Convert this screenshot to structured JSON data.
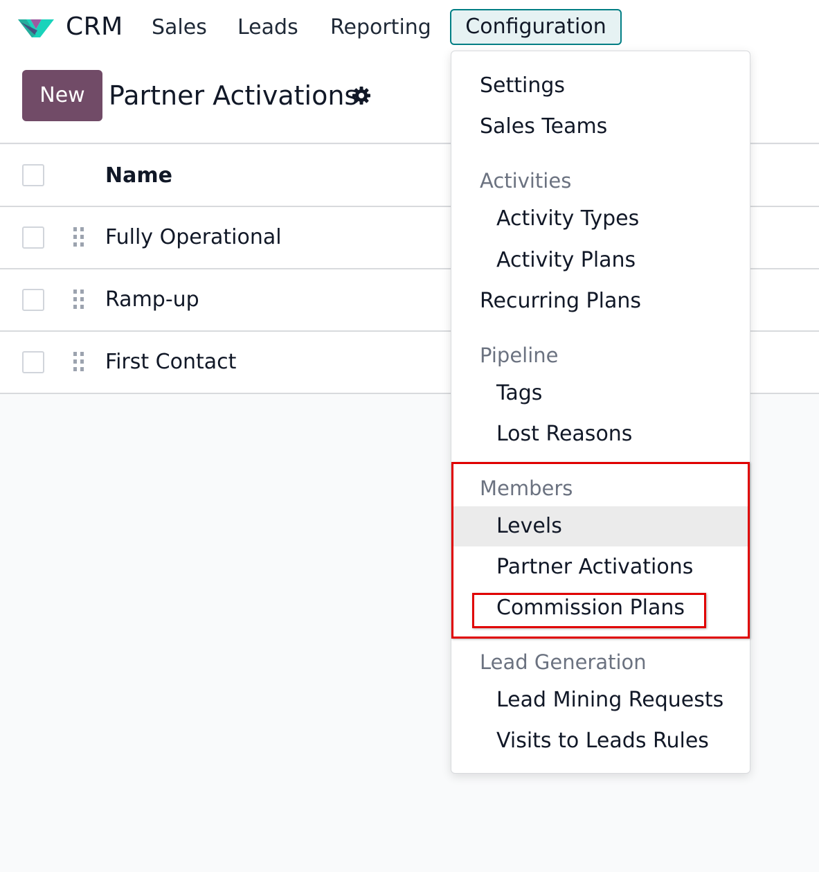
{
  "navbar": {
    "app_name": "CRM",
    "menus": {
      "sales": "Sales",
      "leads": "Leads",
      "reporting": "Reporting",
      "configuration": "Configuration"
    }
  },
  "control_panel": {
    "new_label": "New",
    "title": "Partner Activations"
  },
  "list": {
    "column_name": "Name",
    "rows": [
      {
        "name": "Fully Operational"
      },
      {
        "name": "Ramp-up"
      },
      {
        "name": "First Contact"
      }
    ]
  },
  "dropdown": {
    "settings": "Settings",
    "sales_teams": "Sales Teams",
    "activities_header": "Activities",
    "activity_types": "Activity Types",
    "activity_plans": "Activity Plans",
    "recurring_plans": "Recurring Plans",
    "pipeline_header": "Pipeline",
    "tags": "Tags",
    "lost_reasons": "Lost Reasons",
    "members_header": "Members",
    "levels": "Levels",
    "partner_activations": "Partner Activations",
    "commission_plans": "Commission Plans",
    "lead_generation_header": "Lead Generation",
    "lead_mining_requests": "Lead Mining Requests",
    "visits_to_leads_rules": "Visits to Leads Rules"
  },
  "colors": {
    "brand": "#714b67",
    "accent": "#017e84",
    "highlight": "#e00000"
  }
}
